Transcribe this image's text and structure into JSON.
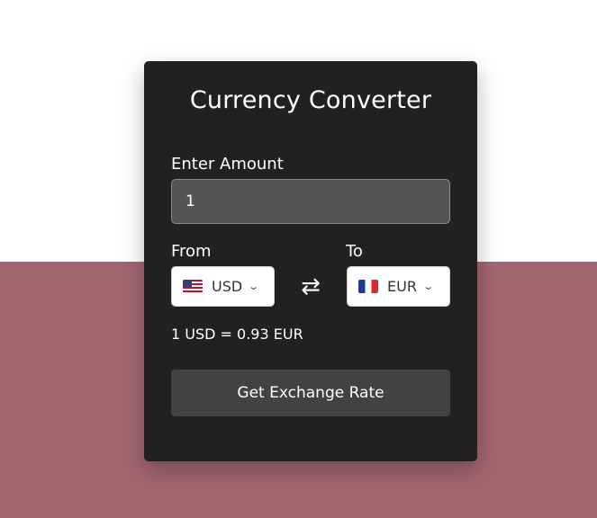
{
  "card": {
    "title": "Currency Converter"
  },
  "amount": {
    "label": "Enter Amount",
    "value": "1"
  },
  "from": {
    "label": "From",
    "currency": "USD",
    "flag_icon": "us-flag-icon"
  },
  "to": {
    "label": "To",
    "currency": "EUR",
    "flag_icon": "fr-flag-icon"
  },
  "swap_icon": "swap-arrows-icon",
  "rate_text": "1 USD = 0.93 EUR",
  "button": {
    "label": "Get Exchange Rate"
  },
  "colors": {
    "page_top": "#ffffff",
    "page_bottom": "#a26671",
    "card": "#212121",
    "input": "#545454",
    "button": "#424242"
  }
}
